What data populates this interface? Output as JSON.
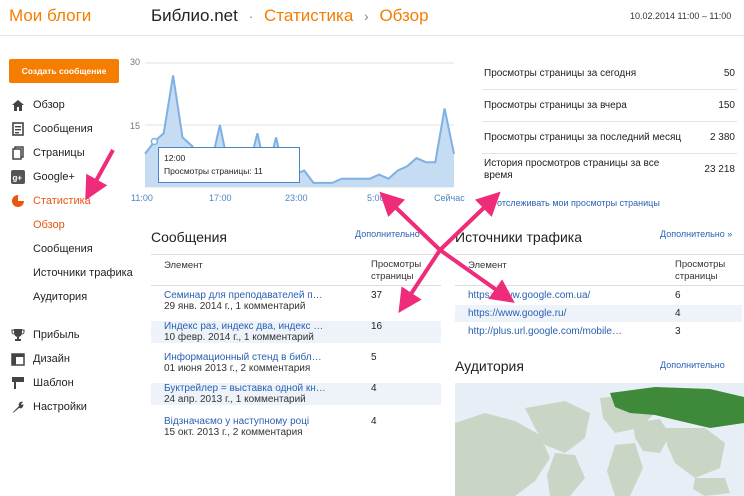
{
  "header": {
    "brand": "Мои блоги",
    "site": "Библио.net",
    "sep1": "·",
    "stats_link": "Статистика",
    "sep2": "›",
    "overview_link": "Обзор",
    "daterange": "10.02.2014 11:00 – 11:00"
  },
  "sidebar": {
    "new_post": "Создать сообщение",
    "items": [
      {
        "label": "Обзор",
        "icon": "home-icon"
      },
      {
        "label": "Сообщения",
        "icon": "posts-icon"
      },
      {
        "label": "Страницы",
        "icon": "pages-icon"
      },
      {
        "label": "Google+",
        "icon": "google-plus-icon"
      },
      {
        "label": "Статистика",
        "icon": "stats-icon",
        "active": true
      }
    ],
    "sub": [
      {
        "label": "Обзор",
        "active": true
      },
      {
        "label": "Сообщения"
      },
      {
        "label": "Источники трафика"
      },
      {
        "label": "Аудитория"
      }
    ],
    "items2": [
      {
        "label": "Прибыль",
        "icon": "trophy-icon"
      },
      {
        "label": "Дизайн",
        "icon": "layout-icon"
      },
      {
        "label": "Шаблон",
        "icon": "template-icon"
      },
      {
        "label": "Настройки",
        "icon": "wrench-icon"
      }
    ]
  },
  "chart_data": {
    "type": "area",
    "x_ticks": [
      "11:00",
      "17:00",
      "23:00",
      "5:00",
      "Сейчас"
    ],
    "y_ticks": [
      "30",
      "15"
    ],
    "ylim": [
      0,
      30
    ],
    "values": [
      8,
      11,
      13,
      27,
      12,
      10,
      7,
      5,
      15,
      4,
      9,
      4,
      13,
      3,
      12,
      2,
      3,
      4,
      1,
      1,
      1,
      2,
      2,
      2,
      2,
      3,
      2,
      4,
      5,
      7,
      6,
      6,
      19,
      8
    ],
    "tooltip_time": "12:00",
    "tooltip_text": "Просмотры страницы: 11",
    "tooltip_index": 1,
    "color": "#7fb0e3"
  },
  "stats": [
    {
      "label": "Просмотры страницы за сегодня",
      "value": "50"
    },
    {
      "label": "Просмотры страницы за вчера",
      "value": "150"
    },
    {
      "label": "Просмотры страницы за последний месяц",
      "value": "2 380"
    },
    {
      "label": "История просмотров страницы за все время",
      "value": "23 218"
    }
  ],
  "untrack": "Не отслеживать мои просмотры страницы",
  "posts_section": {
    "title": "Сообщения",
    "more": "Дополнительно",
    "col1": "Элемент",
    "col2": "Просмотры страницы",
    "rows": [
      {
        "title": "Семинар для преподавателей п…",
        "meta": "29 янв. 2014 г., 1 комментарий",
        "views": "37"
      },
      {
        "title": "Индекс раз, индекс два, индекс …",
        "meta": "10 февр. 2014 г., 1 комментарий",
        "views": "16"
      },
      {
        "title": "Информационный стенд в библ…",
        "meta": "01 июня 2013 г., 2 комментария",
        "views": "5"
      },
      {
        "title": "Буктрейлер = выставка одной кн…",
        "meta": "24 апр. 2013 г., 1 комментарий",
        "views": "4"
      },
      {
        "title": "Відзначаємо у наступному році",
        "meta": "15 окт. 2013 г., 2 комментария",
        "views": "4"
      }
    ]
  },
  "traffic_section": {
    "title": "Источники трафика",
    "more": "Дополнительно »",
    "col1": "Элемент",
    "col2": "Просмотры страницы",
    "rows": [
      {
        "url": "https://www.google.com.ua/",
        "views": "6"
      },
      {
        "url": "https://www.google.ru/",
        "views": "4"
      },
      {
        "url": "http://plus.url.google.com/mobile…",
        "views": "3"
      }
    ]
  },
  "audience_section": {
    "title": "Аудитория",
    "more": "Дополнительно"
  },
  "colors": {
    "accent": "#f57d00",
    "link": "#2a61b3",
    "arrow": "#ee2c7a",
    "chart_fill": "#c6dcf3"
  }
}
